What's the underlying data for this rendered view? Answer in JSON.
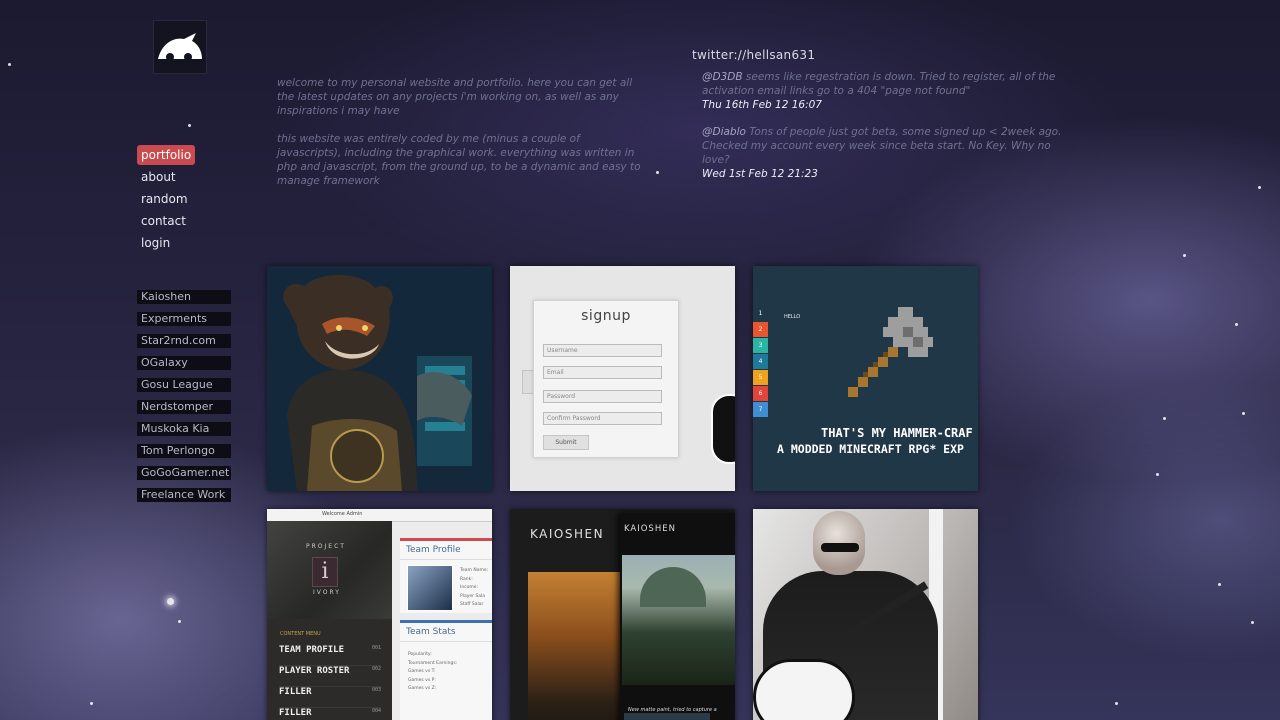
{
  "logo_alt": "site logo",
  "nav": {
    "items": [
      {
        "label": "portfolio",
        "active": true
      },
      {
        "label": "about",
        "active": false
      },
      {
        "label": "random",
        "active": false
      },
      {
        "label": "contact",
        "active": false
      },
      {
        "label": "login",
        "active": false
      }
    ]
  },
  "links": [
    "Kaioshen",
    "Experments",
    "Star2rnd.com",
    "OGalaxy",
    "Gosu League",
    "Nerdstomper",
    "Muskoka Kia",
    "Tom Perlongo",
    "GoGoGamer.net",
    "Freelance Work"
  ],
  "welcome": {
    "p1": "welcome to my personal website and portfolio. here you can get all the latest updates on any projects i'm working on, as well as any inspirations i may have",
    "p2": "this website was entirely coded by me (minus a couple of javascripts), including the graphical work. everything was written in php and javascript, from the ground up, to be a dynamic and easy to manage framework"
  },
  "twitter": {
    "handle": "twitter://hellsan631",
    "tweets": [
      {
        "user": "@D3DB",
        "text": " seems like regestration is down. Tried to register, all of the activation email links go to a 404 \"page not found\"",
        "date": "Thu 16th Feb 12 16:07"
      },
      {
        "user": "@Diablo",
        "text": " Tons of people just got beta, some signed up < 2week ago. Checked my account every week since beta start. No Key. Why no love?",
        "date": "Wed 1st Feb 12 21:23"
      }
    ]
  },
  "tiles": {
    "signup": {
      "title": "signup",
      "fields": [
        "Username",
        "Email",
        "Password",
        "Confirm Password"
      ],
      "button": "Submit"
    },
    "minecraft": {
      "hello": "HELLO",
      "strip": [
        "1",
        "2",
        "3",
        "4",
        "5",
        "6",
        "7"
      ],
      "line1": "THAT'S MY HAMMER-CRAF",
      "line2": "A MODDED MINECRAFT RPG* EXP"
    },
    "ivory": {
      "caption_top": "PROJECT",
      "caption_bottom": "IVORY",
      "welcome": "Welcome Admin",
      "menu_title": "CONTENT MENU",
      "menu": [
        {
          "label": "TEAM PROFILE",
          "num": "001"
        },
        {
          "label": "PLAYER ROSTER",
          "num": "002"
        },
        {
          "label": "FILLER",
          "num": "003"
        },
        {
          "label": "FILLER",
          "num": "004"
        }
      ],
      "panel1": "Team Profile",
      "panel1_rows": [
        "Team Name:",
        "Rank:",
        "Income:",
        "Player Sala",
        "Staff Salar"
      ],
      "panel2": "Team Stats",
      "panel2_rows": [
        "Popularity:",
        "Tournament Earnings:",
        "Games vs T:",
        "Games vs P:",
        "Games vs Z:"
      ]
    },
    "kaioshen": {
      "title": "KAIOSHEN",
      "sub": "KAIOSHEN",
      "caption": "New matte paint, tried to capture a serene, calm atmos"
    }
  }
}
